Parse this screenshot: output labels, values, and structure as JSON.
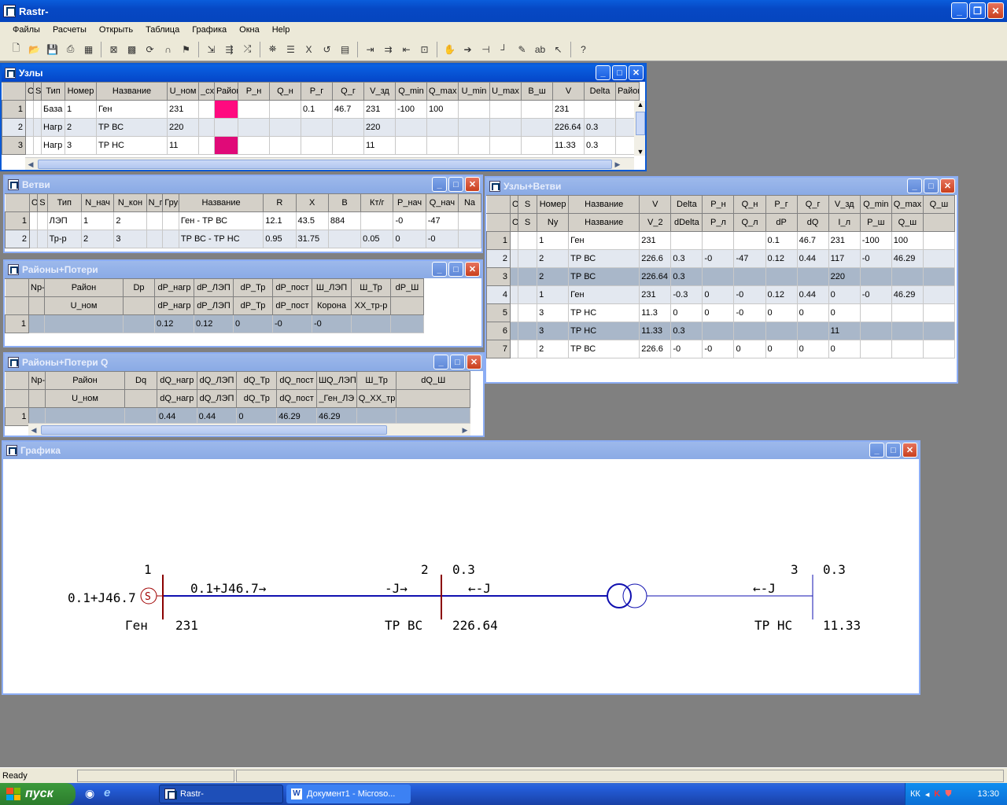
{
  "app": {
    "title": "Rastr-"
  },
  "menu": [
    "Файлы",
    "Расчеты",
    "Открыть",
    "Таблица",
    "Графика",
    "Окна",
    "Help"
  ],
  "toolbar_icons": [
    "new-icon",
    "open-icon",
    "save-icon",
    "print-icon",
    "table-icon",
    "sep",
    "calc-icon",
    "grid-icon",
    "refresh-icon",
    "magnet-icon",
    "flag-icon",
    "sep",
    "branch-icon",
    "node-icon",
    "step-icon",
    "sep",
    "binoculars-icon",
    "form-icon",
    "excel-icon",
    "undo-icon",
    "report-icon",
    "sep",
    "arrow-in-icon",
    "arrow-split-icon",
    "arrow-left-icon",
    "arrow-box-icon",
    "sep",
    "hand-icon",
    "pointer-icon",
    "pin-icon",
    "red-line-icon",
    "edit-icon",
    "text-icon",
    "pick-icon",
    "sep",
    "help-icon"
  ],
  "uzly": {
    "title": "Узлы",
    "headers": [
      "",
      "O",
      "S",
      "Тип",
      "Номер",
      "Название",
      "U_ном",
      "_сх",
      "Район",
      "P_н",
      "Q_н",
      "P_г",
      "Q_г",
      "V_зд",
      "Q_min",
      "Q_max",
      "U_min",
      "U_max",
      "B_ш",
      "V",
      "Delta",
      "Район"
    ],
    "rows": [
      [
        "1",
        "",
        "",
        "База",
        "1",
        "Ген",
        "231",
        "",
        "",
        "",
        "",
        "0.1",
        "46.7",
        "231",
        "-100",
        "100",
        "",
        "",
        "",
        "231",
        "",
        ""
      ],
      [
        "2",
        "",
        "",
        "Нагр",
        "2",
        "ТР ВС",
        "220",
        "",
        "",
        "",
        "",
        "",
        "",
        "220",
        "",
        "",
        "",
        "",
        "",
        "226.64",
        "0.3",
        ""
      ],
      [
        "3",
        "",
        "",
        "Нагр",
        "3",
        "ТР НС",
        "11",
        "",
        "",
        "",
        "",
        "",
        "",
        "11",
        "",
        "",
        "",
        "",
        "",
        "11.33",
        "0.3",
        ""
      ]
    ]
  },
  "vetvi": {
    "title": "Ветви",
    "headers": [
      "",
      "O",
      "S",
      "Тип",
      "N_нач",
      "N_кон",
      "N_п",
      "Груп",
      "Название",
      "R",
      "X",
      "B",
      "Кт/г",
      "P_нач",
      "Q_нач",
      "Na"
    ],
    "rows": [
      [
        "1",
        "",
        "",
        "ЛЭП",
        "1",
        "2",
        "",
        "",
        "Ген - ТР ВС",
        "12.1",
        "43.5",
        "884",
        "",
        "-0",
        "-47",
        ""
      ],
      [
        "2",
        "",
        "",
        "Тр-р",
        "2",
        "3",
        "",
        "",
        "ТР ВС - ТР НС",
        "0.95",
        "31.75",
        "",
        "0.05",
        "0",
        "-0",
        ""
      ]
    ]
  },
  "rayony_p": {
    "title": "Районы+Потери",
    "headers1": [
      "",
      "Nр-н",
      "Район",
      "Dp",
      "dP_нагр",
      "dP_ЛЭП",
      "dP_Тр",
      "dP_пост",
      "Ш_ЛЭП",
      "Ш_Тр",
      "dP_Ш"
    ],
    "headers2": [
      "",
      "",
      "U_ном",
      "",
      "dP_нагр",
      "dP_ЛЭП",
      "dP_Тр",
      "dP_пост",
      "Корона",
      "ХХ_тр-р",
      ""
    ],
    "rows": [
      [
        "1",
        "",
        "",
        "",
        "0.12",
        "0.12",
        "0",
        "-0",
        "-0",
        "",
        ""
      ]
    ]
  },
  "rayony_q": {
    "title": "Районы+Потери Q",
    "headers1": [
      "",
      "Nр-н",
      "Район",
      "Dq",
      "dQ_нагр",
      "dQ_ЛЭП",
      "dQ_Тр",
      "dQ_пост",
      "ШQ_ЛЭП",
      "Ш_Тр",
      "dQ_Ш"
    ],
    "headers2": [
      "",
      "",
      "U_ном",
      "",
      "dQ_нагр",
      "dQ_ЛЭП",
      "dQ_Тр",
      "dQ_пост",
      "_Ген_ЛЭ",
      "Q_ХХ_тр-р",
      ""
    ],
    "rows": [
      [
        "1",
        "",
        "",
        "",
        "0.44",
        "0.44",
        "0",
        "46.29",
        "46.29",
        "",
        ""
      ]
    ]
  },
  "uzly_vetvi": {
    "title": "Узлы+Ветви",
    "headers1": [
      "",
      "O",
      "S",
      "Номер",
      "Название",
      "V",
      "Delta",
      "P_н",
      "Q_н",
      "P_г",
      "Q_г",
      "V_зд",
      "Q_min",
      "Q_max",
      "Q_ш"
    ],
    "headers2": [
      "",
      "O",
      "S",
      "Ny",
      "Название",
      "V_2",
      "dDelta",
      "P_л",
      "Q_л",
      "dP",
      "dQ",
      "I_л",
      "P_ш",
      "Q_ш",
      ""
    ],
    "rows": [
      [
        "1",
        "",
        "",
        "1",
        "Ген",
        "231",
        "",
        "",
        "",
        "0.1",
        "46.7",
        "231",
        "-100",
        "100",
        ""
      ],
      [
        "2",
        "",
        "",
        "2",
        "ТР ВС",
        "226.6",
        "0.3",
        "-0",
        "-47",
        "0.12",
        "0.44",
        "117",
        "-0",
        "46.29",
        ""
      ],
      [
        "3",
        "",
        "",
        "2",
        "ТР ВС",
        "226.64",
        "0.3",
        "",
        "",
        "",
        "",
        "220",
        "",
        "",
        ""
      ],
      [
        "4",
        "",
        "",
        "1",
        "Ген",
        "231",
        "-0.3",
        "0",
        "-0",
        "0.12",
        "0.44",
        "0",
        "-0",
        "46.29",
        ""
      ],
      [
        "5",
        "",
        "",
        "3",
        "ТР НС",
        "11.3",
        "0",
        "0",
        "-0",
        "0",
        "0",
        "0",
        "",
        "",
        ""
      ],
      [
        "6",
        "",
        "",
        "3",
        "ТР НС",
        "11.33",
        "0.3",
        "",
        "",
        "",
        "",
        "11",
        "",
        "",
        ""
      ],
      [
        "7",
        "",
        "",
        "2",
        "ТР ВС",
        "226.6",
        "-0",
        "-0",
        "0",
        "0",
        "0",
        "0",
        "",
        "",
        ""
      ]
    ]
  },
  "grafika": {
    "title": "Графика",
    "node1": {
      "num": "1",
      "name": "Ген",
      "v": "231",
      "gen": "0.1+J46.7",
      "flow": "0.1+J46.7→"
    },
    "node2": {
      "num": "2",
      "delta": "0.3",
      "name": "ТР ВС",
      "v": "226.64",
      "flow_in": "-J→",
      "flow_out": "←-J"
    },
    "node3": {
      "num": "3",
      "delta": "0.3",
      "name": "ТР НС",
      "v": "11.33",
      "flow_in": "←-J"
    }
  },
  "status": {
    "text": "Ready"
  },
  "taskbar": {
    "start": "пуск",
    "tasks": [
      "Rastr-",
      "Документ1 - Microso..."
    ],
    "lang": "КК",
    "time": "13:30"
  }
}
